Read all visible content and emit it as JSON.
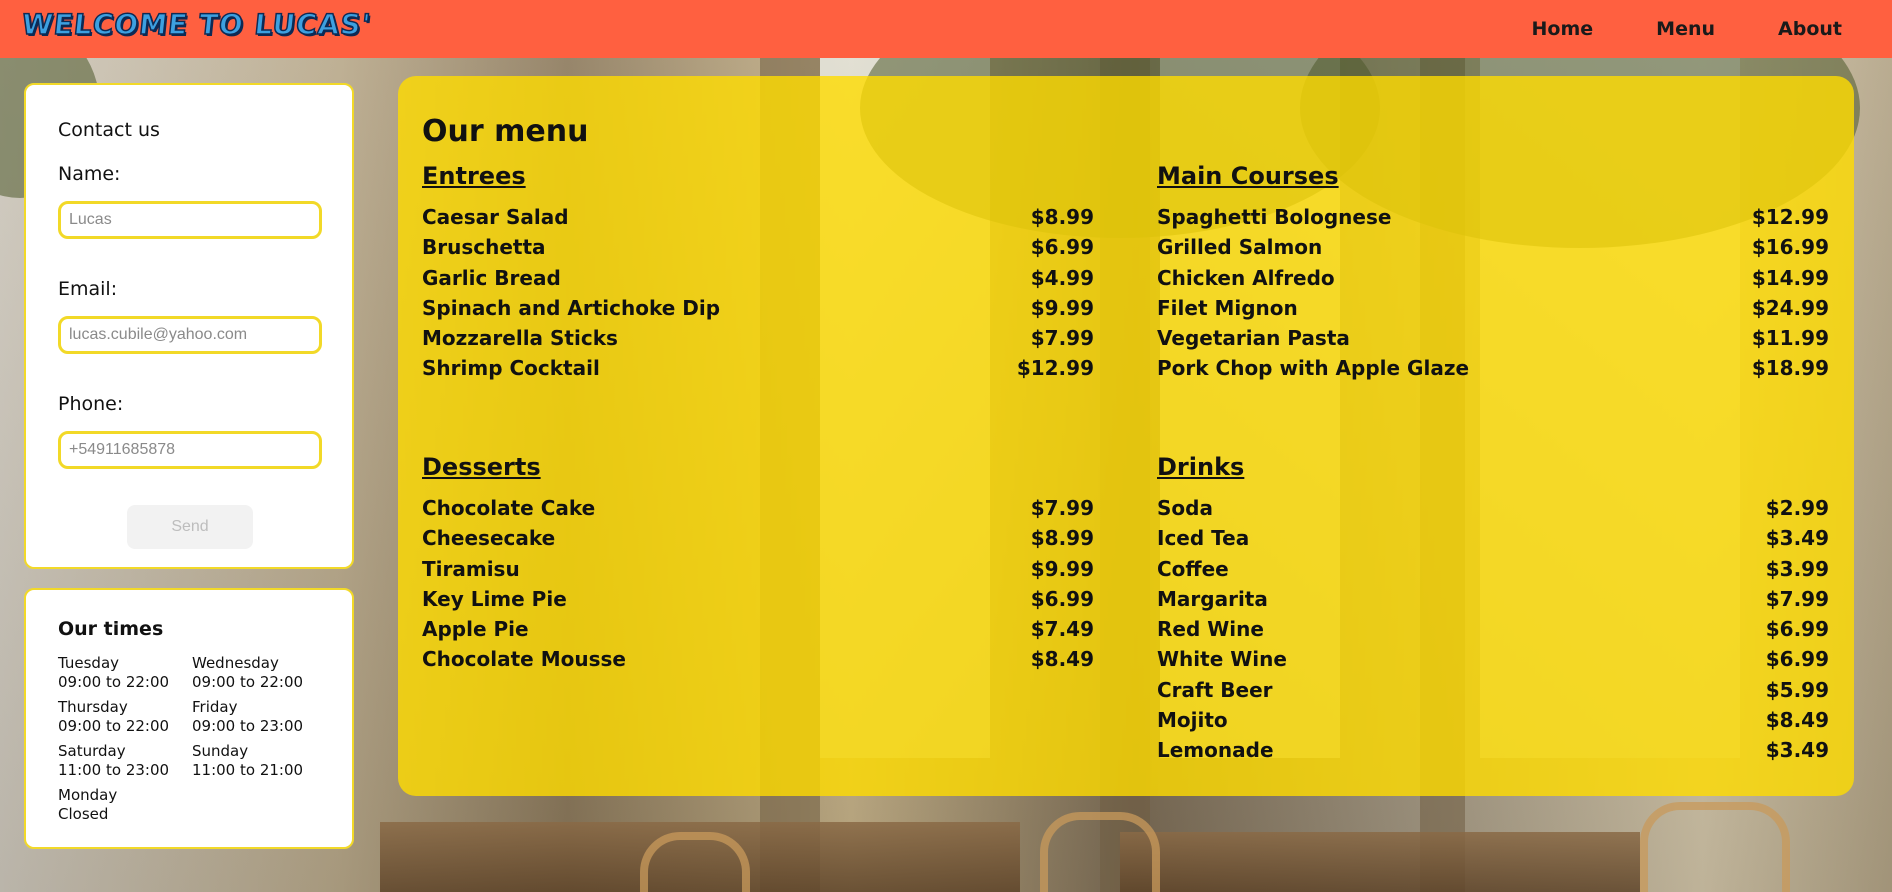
{
  "header": {
    "logo_text": "WELCOME TO LUCAS'",
    "nav": [
      "Home",
      "Menu",
      "About"
    ]
  },
  "contact": {
    "title": "Contact us",
    "name_label": "Name:",
    "name_placeholder": "Lucas",
    "email_label": "Email:",
    "email_placeholder": "lucas.cubile@yahoo.com",
    "phone_label": "Phone:",
    "phone_placeholder": "+54911685878",
    "send_label": "Send"
  },
  "times": {
    "title": "Our times",
    "days": [
      {
        "day": "Tuesday",
        "hours": "09:00 to 22:00"
      },
      {
        "day": "Wednesday",
        "hours": "09:00 to 22:00"
      },
      {
        "day": "Thursday",
        "hours": "09:00 to 22:00"
      },
      {
        "day": "Friday",
        "hours": "09:00 to 23:00"
      },
      {
        "day": "Saturday",
        "hours": "11:00 to 23:00"
      },
      {
        "day": "Sunday",
        "hours": "11:00 to 21:00"
      },
      {
        "day": "Monday",
        "hours": "Closed"
      }
    ]
  },
  "menu": {
    "title": "Our menu",
    "sections": [
      {
        "name": "Entrees",
        "items": [
          {
            "name": "Caesar Salad",
            "price": "$8.99"
          },
          {
            "name": "Bruschetta",
            "price": "$6.99"
          },
          {
            "name": "Garlic Bread",
            "price": "$4.99"
          },
          {
            "name": "Spinach and Artichoke Dip",
            "price": "$9.99"
          },
          {
            "name": "Mozzarella Sticks",
            "price": "$7.99"
          },
          {
            "name": "Shrimp Cocktail",
            "price": "$12.99"
          }
        ]
      },
      {
        "name": "Main Courses",
        "items": [
          {
            "name": "Spaghetti Bolognese",
            "price": "$12.99"
          },
          {
            "name": "Grilled Salmon",
            "price": "$16.99"
          },
          {
            "name": "Chicken Alfredo",
            "price": "$14.99"
          },
          {
            "name": "Filet Mignon",
            "price": "$24.99"
          },
          {
            "name": "Vegetarian Pasta",
            "price": "$11.99"
          },
          {
            "name": "Pork Chop with Apple Glaze",
            "price": "$18.99"
          }
        ]
      },
      {
        "name": "Desserts",
        "items": [
          {
            "name": "Chocolate Cake",
            "price": "$7.99"
          },
          {
            "name": "Cheesecake",
            "price": "$8.99"
          },
          {
            "name": "Tiramisu",
            "price": "$9.99"
          },
          {
            "name": "Key Lime Pie",
            "price": "$6.99"
          },
          {
            "name": "Apple Pie",
            "price": "$7.49"
          },
          {
            "name": "Chocolate Mousse",
            "price": "$8.49"
          }
        ]
      },
      {
        "name": "Drinks",
        "items": [
          {
            "name": "Soda",
            "price": "$2.99"
          },
          {
            "name": "Iced Tea",
            "price": "$3.49"
          },
          {
            "name": "Coffee",
            "price": "$3.99"
          },
          {
            "name": "Margarita",
            "price": "$7.99"
          },
          {
            "name": "Red Wine",
            "price": "$6.99"
          },
          {
            "name": "White Wine",
            "price": "$6.99"
          },
          {
            "name": "Craft Beer",
            "price": "$5.99"
          },
          {
            "name": "Mojito",
            "price": "$8.49"
          },
          {
            "name": "Lemonade",
            "price": "$3.49"
          }
        ]
      }
    ]
  },
  "colors": {
    "header_bg": "#ff6040",
    "accent_yellow": "#f2d928",
    "menu_panel": "#ffdc00"
  }
}
